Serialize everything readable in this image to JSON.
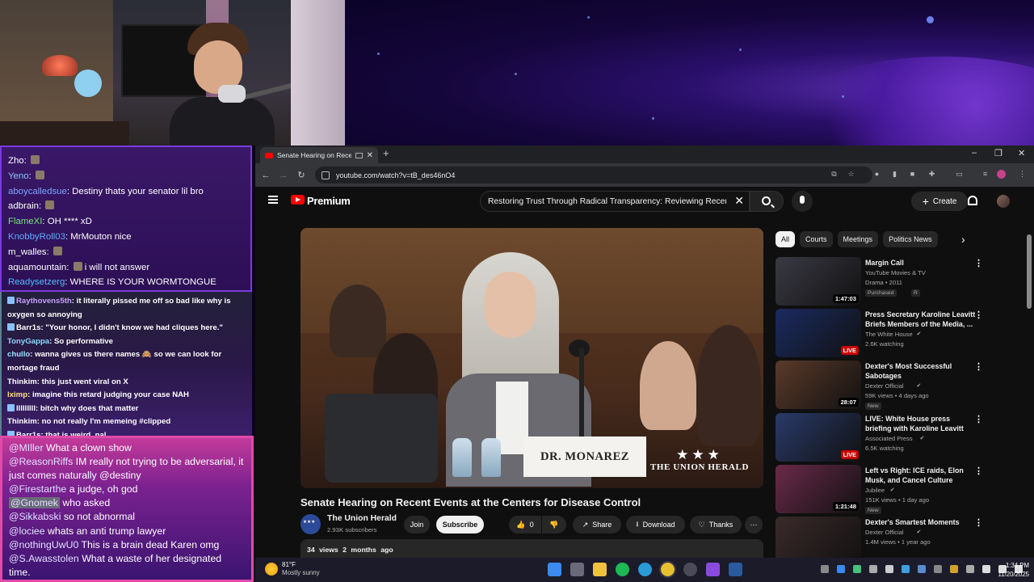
{
  "chat_top": {
    "messages": [
      {
        "user": "Zho",
        "user_color": "#ffffff",
        "text": "",
        "emote": true
      },
      {
        "user": "Yeno",
        "user_color": "#8cc8ff",
        "text": "",
        "emote": true
      },
      {
        "user": "aboycalledsue",
        "user_color": "#7aa6ff",
        "text": "Destiny thats your senator lil bro"
      },
      {
        "user": "adbrain",
        "user_color": "#ffffff",
        "text": "",
        "emote": true
      },
      {
        "user": "FlameXI",
        "user_color": "#7ee07e",
        "text": "OH **** xD"
      },
      {
        "user": "KnobbyRoll03",
        "user_color": "#5bb0ff",
        "text": "MrMouton nice"
      },
      {
        "user": "m_walles",
        "user_color": "#ffffff",
        "text": "",
        "emote": true
      },
      {
        "user": "aquamountain",
        "user_color": "#ffffff",
        "text": "i will not answer",
        "emote": true
      },
      {
        "user": "Readysetzerg",
        "user_color": "#4ac0ff",
        "text": "WHERE IS YOUR WORMTONGUE"
      }
    ]
  },
  "chat_mid": {
    "messages": [
      {
        "user": "Raythovens5th",
        "user_color": "#c8a0ff",
        "text": "it literally pissed me off so bad like why is oxygen so annoying",
        "badge": true
      },
      {
        "user": "Barr1s",
        "user_color": "#ffffff",
        "text": "\"Your honor, I didn't know we had cliques here.\"",
        "badge": true
      },
      {
        "user": "TonyGappa",
        "user_color": "#8cd8ff",
        "text": "So performative"
      },
      {
        "user": "chullo",
        "user_color": "#a0e0ff",
        "text": "wanna gives us there names 🙈 so we can look for mortage fraud"
      },
      {
        "user": "Thinkim",
        "user_color": "#ffffff",
        "text": "this just went viral on X"
      },
      {
        "user": "lximp",
        "user_color": "#ffe28a",
        "text": "imagine this retard judging your case NAH"
      },
      {
        "user": "lllllllll",
        "user_color": "#ffffff",
        "text": "bitch why does that matter",
        "badge": true
      },
      {
        "user": "Thinkim",
        "user_color": "#ffffff",
        "text": "no not really I'm memeing #clipped"
      },
      {
        "user": "Barr1s",
        "user_color": "#ffffff",
        "text": "that is weird. nal",
        "badge": true
      }
    ]
  },
  "chat_bottom": {
    "messages": [
      {
        "user": "@MIller",
        "text": "What a clown show"
      },
      {
        "user": "@ReasonRiffs",
        "text": "IM really not trying to be adversarial, it just comes naturally @destiny"
      },
      {
        "user": "@Firestarthe",
        "text": "a judge, oh god"
      },
      {
        "user": "@Gnomek",
        "text": "who asked",
        "highlight": true
      },
      {
        "user": "@Sikkabski",
        "text": "so not abnormal"
      },
      {
        "user": "@lociee",
        "text": "whats an anti trump lawyer"
      },
      {
        "user": "@nothingUwU0",
        "text": "This is a brain dead Karen omg"
      },
      {
        "user": "@S.Awasstolen",
        "text": "What a waste of her designated time."
      }
    ]
  },
  "browser": {
    "tab_title": "Senate Hearing on Recent E",
    "url": "youtube.com/watch?v=tB_des46nO4",
    "window_controls": [
      "–",
      "❐",
      "✕"
    ]
  },
  "youtube": {
    "brand": "Premium",
    "search_query": "Restoring Trust Through Radical Transparency: Reviewing Recent Events at the Centers for Disease Control",
    "create_label": "Create",
    "video": {
      "nameplate": "DR. MONAREZ",
      "watermark": "THE UNION HERALD",
      "title": "Senate Hearing on Recent Events at the Centers for Disease Control",
      "channel": "The Union Herald",
      "subscribers": "2.93K subscribers",
      "join_label": "Join",
      "subscribe_label": "Subscribe",
      "likes": "0",
      "share_label": "Share",
      "download_label": "Download",
      "thanks_label": "Thanks",
      "views": "34 views",
      "age": "2 months ago"
    },
    "chips": [
      "All",
      "Courts",
      "Meetings",
      "Politics News"
    ],
    "recommendations": [
      {
        "title": "Margin Call",
        "channel": "YouTube Movies & TV",
        "meta": "Drama • 2011",
        "badges": [
          "Purchased",
          "R"
        ],
        "duration": "1:47:03",
        "thumb": "#3a3a44"
      },
      {
        "title": "Press Secretary Karoline Leavitt Briefs Members of the Media, ...",
        "channel": "The White House",
        "verified": true,
        "meta": "2.6K watching",
        "live": "LIVE",
        "thumb": "#1a2a60"
      },
      {
        "title": "Dexter's Most Successful Sabotages",
        "channel": "Dexter Official",
        "verified": true,
        "meta": "59K views • 4 days ago",
        "badges": [
          "New"
        ],
        "duration": "28:07",
        "thumb": "#5a3a2a"
      },
      {
        "title": "LIVE: White House press briefing with Karoline Leavitt",
        "channel": "Associated Press",
        "verified": true,
        "meta": "6.5K watching",
        "live": "LIVE",
        "thumb": "#2a3a6a"
      },
      {
        "title": "Left vs Right: ICE raids, Elon Musk, and Cancel Culture",
        "channel": "Jubilee",
        "verified": true,
        "meta": "151K views • 1 day ago",
        "badges": [
          "New"
        ],
        "duration": "1:21:48",
        "thumb": "#6a2a4a"
      },
      {
        "title": "Dexter's Smartest Moments",
        "channel": "Dexter Official",
        "verified": true,
        "meta": "1.4M views • 1 year ago",
        "thumb": "#3a2a2a"
      }
    ]
  },
  "taskbar": {
    "temperature": "81°F",
    "weather": "Mostly sunny",
    "time": "1:34 PM",
    "date": "11/20/2025"
  }
}
